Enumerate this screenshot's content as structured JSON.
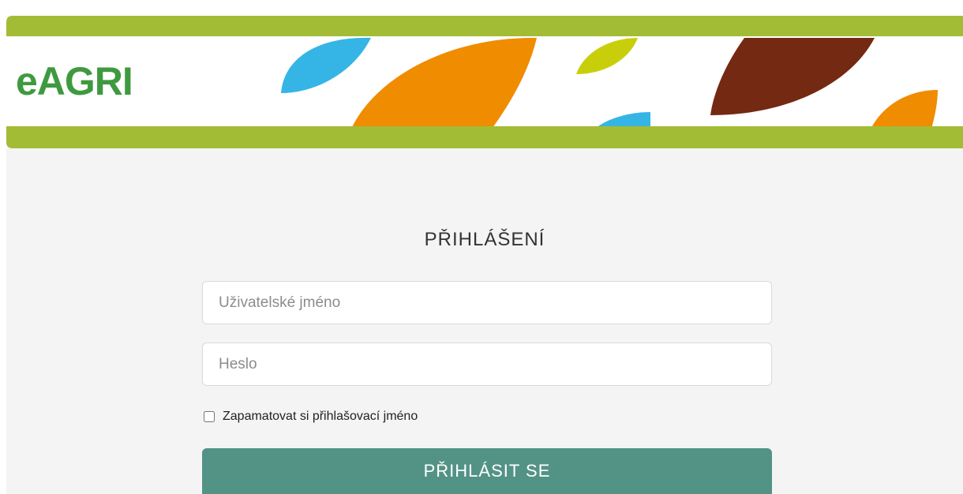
{
  "header": {
    "logo_text": "eAGRI",
    "colors": {
      "green_band": "#a3bc35",
      "leaf_blue": "#35b5e5",
      "leaf_orange": "#f08c00",
      "leaf_lime": "#c8cf0a",
      "leaf_brown": "#732912",
      "logo": "#3f9a3f"
    }
  },
  "login": {
    "title": "PŘIHLÁŠENÍ",
    "username_placeholder": "Uživatelské jméno",
    "password_placeholder": "Heslo",
    "remember_label": "Zapamatovat si přihlašovací jméno",
    "remember_checked": false,
    "submit_label": "PŘIHLÁSIT SE",
    "submit_color": "#539385"
  }
}
